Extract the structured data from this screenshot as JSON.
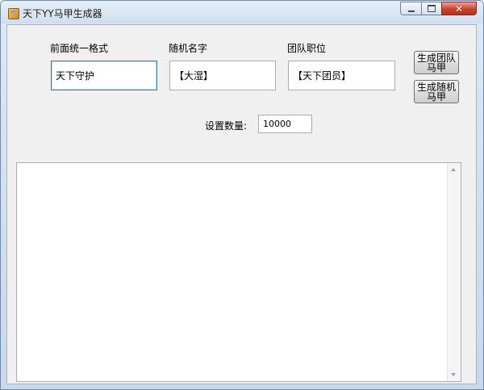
{
  "window": {
    "title": "天下YY马甲生成器"
  },
  "titlebar_controls": {
    "close_glyph": "✕"
  },
  "form": {
    "prefix_label": "前面统一格式",
    "prefix_value": "天下守护",
    "random_name_label": "随机名字",
    "random_name_value": "【大湿】",
    "team_position_label": "团队职位",
    "team_position_value": "【天下团员】",
    "count_label": "设置数量:",
    "count_value": "10000"
  },
  "buttons": {
    "generate_team_line1": "生成团队",
    "generate_team_line2": "马甲",
    "generate_random_line1": "生成随机",
    "generate_random_line2": "马甲"
  },
  "output": {
    "text": ""
  },
  "icons": {
    "app": "app-icon",
    "minimize": "minimize-icon",
    "maximize": "maximize-icon",
    "close": "close-icon",
    "scroll_up": "scroll-up-arrow-icon",
    "scroll_down": "scroll-down-arrow-icon"
  }
}
